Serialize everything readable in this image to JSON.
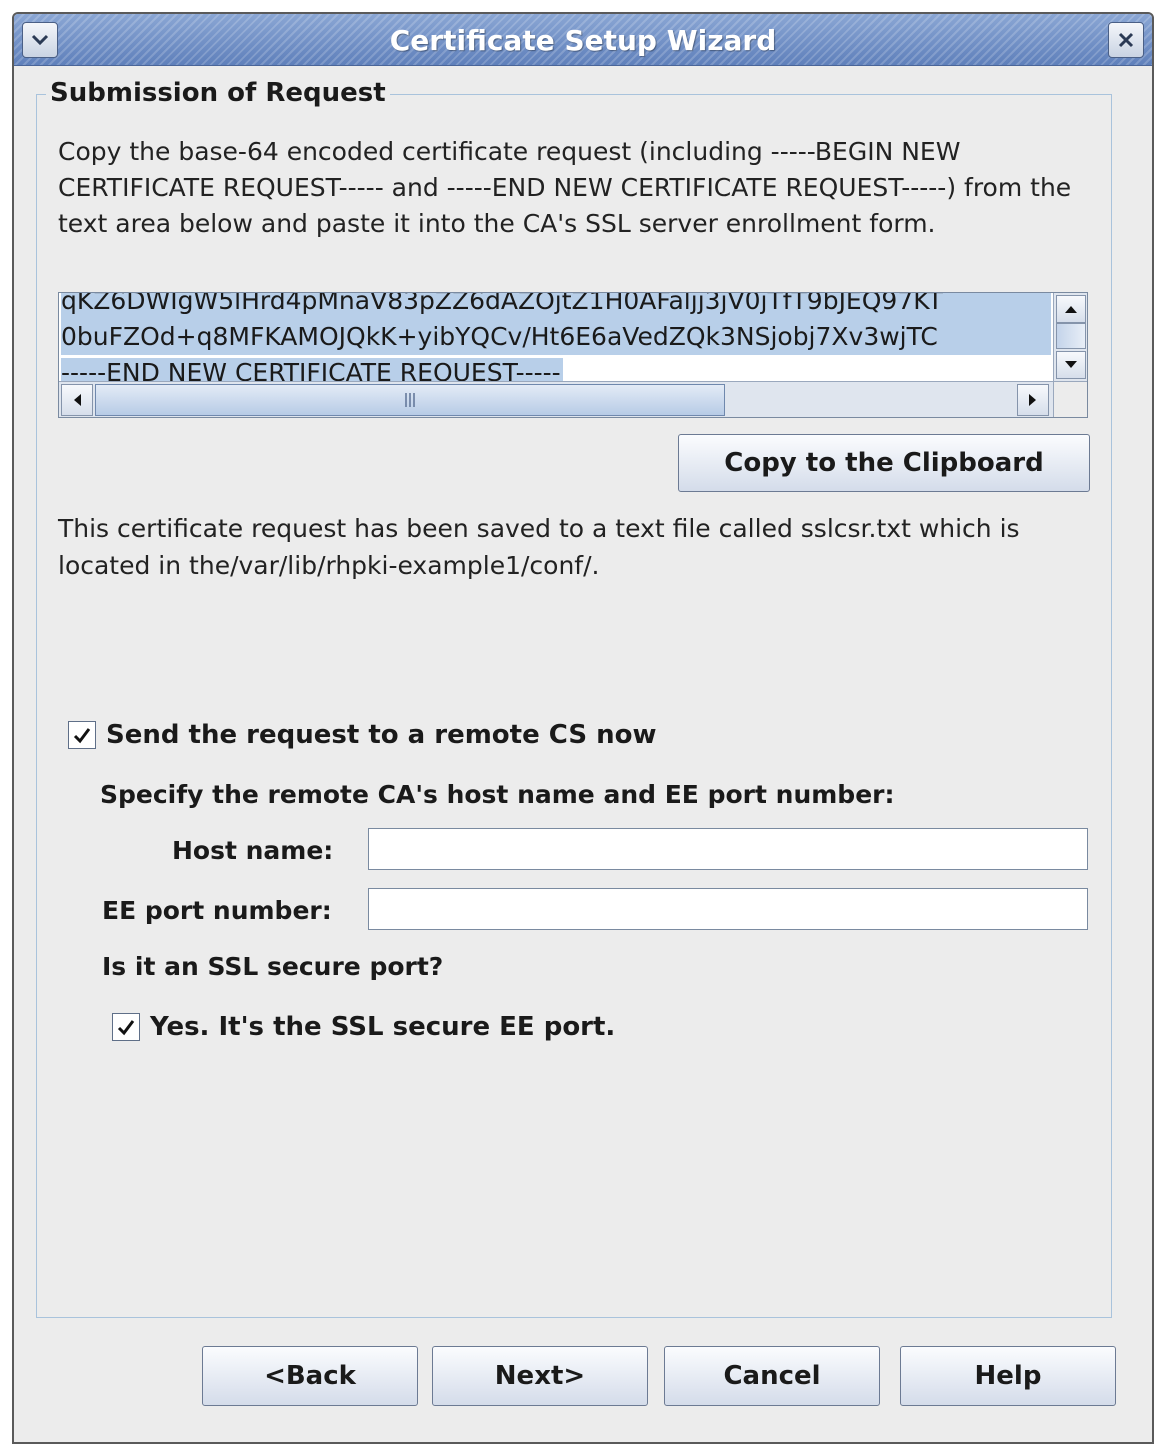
{
  "window": {
    "title": "Certificate Setup Wizard"
  },
  "group": {
    "legend": "Submission of Request",
    "description": "Copy the base-64 encoded certificate request (including -----BEGIN NEW CERTIFICATE REQUEST----- and -----END NEW CERTIFICATE REQUEST-----) from the text area below and paste it into the CA's SSL server enrollment form."
  },
  "request_text": {
    "line1": "qKZ6DWIgW5lHrd4pMnaV83pZZ6dAZOjtZ1H0AFaljj3jV0jTfT9bJEQ97KT",
    "line2": "0buFZOd+q8MFKAMOJQkK+yibYQCv/Ht6E6aVedZQk3NSjobj7Xv3wjTC",
    "line3": "-----END NEW CERTIFICATE REQUEST-----"
  },
  "copy_button": "Copy to the Clipboard",
  "saved_text": "This certificate request has been saved to a text file called sslcsr.txt which is located in the/var/lib/rhpki-example1/conf/.",
  "send_remote": {
    "checked": true,
    "label": "Send the request to a remote CS now"
  },
  "remote": {
    "instruction": "Specify the remote CA's host name and EE port number:",
    "host_label": "Host name:",
    "host_value": "",
    "port_label": "EE port number:",
    "port_value": "",
    "ssl_question": "Is it an SSL secure port?",
    "ssl_checked": true,
    "ssl_label": "Yes. It's the SSL secure EE port."
  },
  "nav": {
    "back": "<Back",
    "next": "Next>",
    "cancel": "Cancel",
    "help": "Help"
  }
}
